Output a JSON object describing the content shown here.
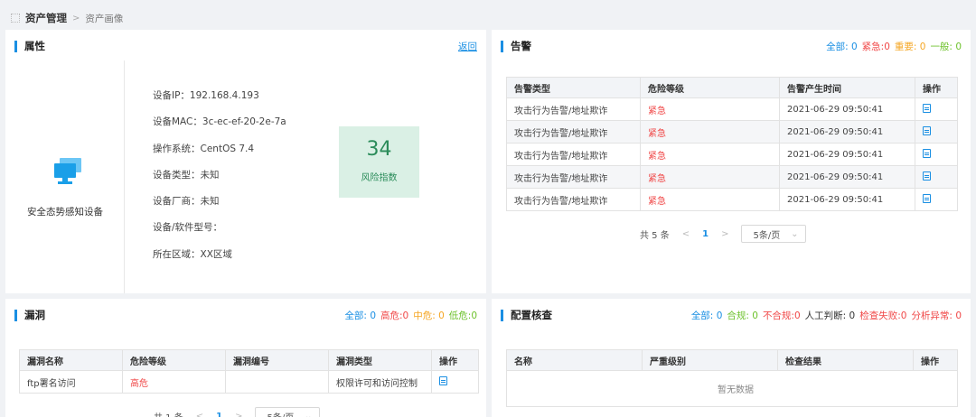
{
  "breadcrumb": {
    "current": "资产管理",
    "sub": "资产画像"
  },
  "attr": {
    "title": "属性",
    "back": "返回",
    "device_name": "安全态势感知设备",
    "props": [
      "设备IP：192.168.4.193",
      "设备MAC：3c-ec-ef-20-2e-7a",
      "操作系统：CentOS 7.4",
      "设备类型：未知",
      "设备厂商：未知",
      "设备/软件型号：",
      "所在区域：XX区域"
    ],
    "risk_value": "34",
    "risk_label": "风险指数"
  },
  "alarm": {
    "title": "告警",
    "filters": {
      "all": "全部: 0",
      "urgent": "紧急:0",
      "important": "重要: 0",
      "normal": "一般: 0"
    },
    "columns": [
      "告警类型",
      "危险等级",
      "告警产生时间",
      "操作"
    ],
    "rows": [
      {
        "type": "攻击行为告警/地址欺诈",
        "level": "紧急",
        "time": "2021-06-29 09:50:41"
      },
      {
        "type": "攻击行为告警/地址欺诈",
        "level": "紧急",
        "time": "2021-06-29 09:50:41"
      },
      {
        "type": "攻击行为告警/地址欺诈",
        "level": "紧急",
        "time": "2021-06-29 09:50:41"
      },
      {
        "type": "攻击行为告警/地址欺诈",
        "level": "紧急",
        "time": "2021-06-29 09:50:41"
      },
      {
        "type": "攻击行为告警/地址欺诈",
        "level": "紧急",
        "time": "2021-06-29 09:50:41"
      }
    ],
    "pager": {
      "total": "共 5 条",
      "page": "1",
      "size": "5条/页"
    }
  },
  "vuln": {
    "title": "漏洞",
    "filters": {
      "all": "全部: 0",
      "high": "高危:0",
      "mid": "中危: 0",
      "low": "低危:0"
    },
    "columns": [
      "漏洞名称",
      "危险等级",
      "漏洞编号",
      "漏洞类型",
      "操作"
    ],
    "rows": [
      {
        "name": "ftp署名访问",
        "level": "高危",
        "id": "",
        "type": "权限许可和访问控制"
      }
    ],
    "pager": {
      "total": "共 1 条",
      "page": "1",
      "size": "5条/页"
    }
  },
  "config": {
    "title": "配置核查",
    "filters": {
      "all": "全部: 0",
      "ok": "合规: 0",
      "bad": "不合规:0",
      "manual": "人工判断: 0",
      "fail": "检查失败:0",
      "err": "分析异常: 0"
    },
    "columns": [
      "名称",
      "严重级别",
      "检查结果",
      "操作"
    ],
    "empty": "暂无数据"
  }
}
